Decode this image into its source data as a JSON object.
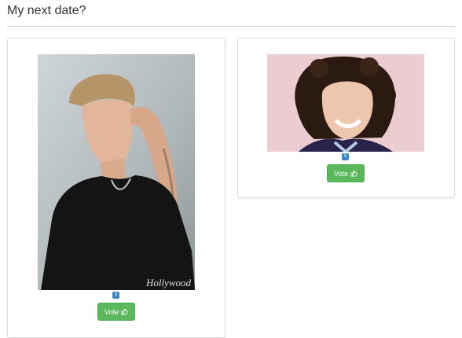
{
  "header": {
    "title": "My next date?"
  },
  "candidates": [
    {
      "votes": "0",
      "vote_label": "Vote",
      "vote_icon": "thumbs-up-icon",
      "watermark": "Hollywood"
    },
    {
      "votes": "0",
      "vote_label": "Vote",
      "vote_icon": "thumbs-up-icon"
    }
  ],
  "colors": {
    "vote_button": "#5cb85c",
    "count_badge": "#3a87c8"
  }
}
